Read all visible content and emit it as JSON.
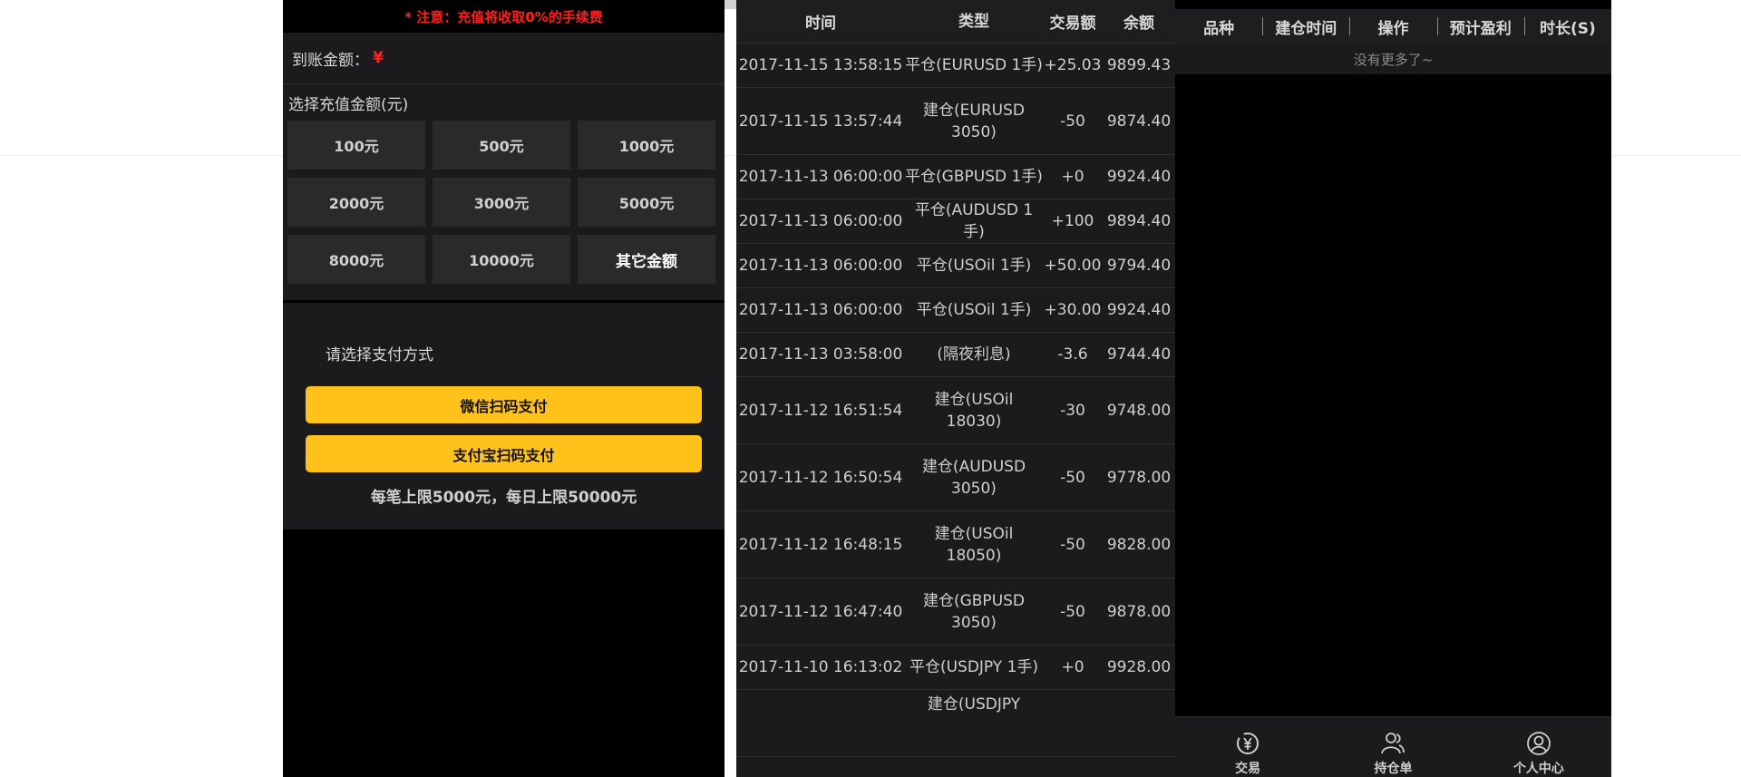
{
  "recharge": {
    "notice": "* 注意：充值将收取0%的手续费",
    "arrival_label": "到账金额：",
    "arrival_currency": "¥",
    "amount_title": "选择充值金额(元)",
    "amounts": [
      "100元",
      "500元",
      "1000元",
      "2000元",
      "3000元",
      "5000元",
      "8000元",
      "10000元",
      "其它金额"
    ],
    "pay_title": "请选择支付方式",
    "pay_wechat": "微信扫码支付",
    "pay_alipay": "支付宝扫码支付",
    "limit_text": "每笔上限5000元，每日上限50000元"
  },
  "records": {
    "headers": {
      "time": "时间",
      "type": "类型",
      "amount": "交易额",
      "balance": "余额"
    },
    "rows": [
      {
        "time": "2017-11-15 13:58:15",
        "type": "平仓(EURUSD 1手)",
        "amount": "+25.03",
        "balance": "9899.43"
      },
      {
        "time": "2017-11-15 13:57:44",
        "type": "建仓(EURUSD 3050)",
        "amount": "-50",
        "balance": "9874.40"
      },
      {
        "time": "2017-11-13 06:00:00",
        "type": "平仓(GBPUSD 1手)",
        "amount": "+0",
        "balance": "9924.40"
      },
      {
        "time": "2017-11-13 06:00:00",
        "type": "平仓(AUDUSD 1手)",
        "amount": "+100",
        "balance": "9894.40"
      },
      {
        "time": "2017-11-13 06:00:00",
        "type": "平仓(USOil 1手)",
        "amount": "+50.00",
        "balance": "9794.40"
      },
      {
        "time": "2017-11-13 06:00:00",
        "type": "平仓(USOil 1手)",
        "amount": "+30.00",
        "balance": "9924.40"
      },
      {
        "time": "2017-11-13 03:58:00",
        "type": "(隔夜利息)",
        "amount": "-3.6",
        "balance": "9744.40"
      },
      {
        "time": "2017-11-12 16:51:54",
        "type": "建仓(USOil 18030)",
        "amount": "-30",
        "balance": "9748.00"
      },
      {
        "time": "2017-11-12 16:50:54",
        "type": "建仓(AUDUSD 3050)",
        "amount": "-50",
        "balance": "9778.00"
      },
      {
        "time": "2017-11-12 16:48:15",
        "type": "建仓(USOil 18050)",
        "amount": "-50",
        "balance": "9828.00"
      },
      {
        "time": "2017-11-12 16:47:40",
        "type": "建仓(GBPUSD 3050)",
        "amount": "-50",
        "balance": "9878.00"
      },
      {
        "time": "2017-11-10 16:13:02",
        "type": "平仓(USDJPY 1手)",
        "amount": "+0",
        "balance": "9928.00"
      },
      {
        "time": "",
        "type": "建仓(USDJPY",
        "amount": "",
        "balance": ""
      }
    ]
  },
  "positions": {
    "headers": [
      "品种",
      "建仓时间",
      "操作",
      "预计盈利",
      "时长(S)"
    ],
    "empty_text": "没有更多了~",
    "tabs": [
      {
        "label": "交易",
        "icon": "yen-circle-icon"
      },
      {
        "label": "持仓单",
        "icon": "users-icon"
      },
      {
        "label": "个人中心",
        "icon": "user-circle-icon"
      }
    ]
  },
  "colors": {
    "accent": "#ffc21a",
    "warning": "#ff1f1f",
    "panel": "#1b1b1d"
  }
}
